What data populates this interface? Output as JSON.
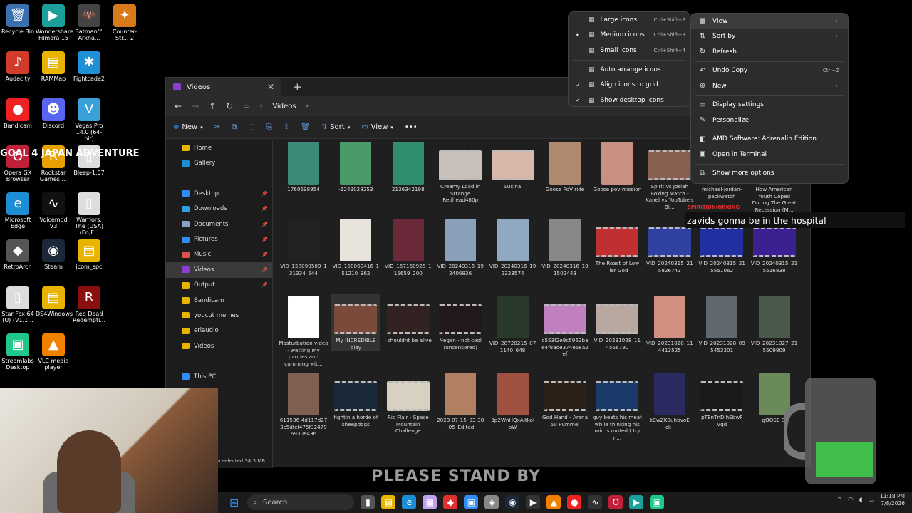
{
  "desktop": {
    "icons": [
      {
        "label": "Recycle Bin",
        "glyph": "🗑",
        "color": "#3a6fb0",
        "icon": "recycle-bin-icon"
      },
      {
        "label": "Wondershare Filmora 15",
        "glyph": "▶",
        "color": "#1b9f9a",
        "icon": "filmora-icon"
      },
      {
        "label": "Batman™ Arkha...",
        "glyph": "🦇",
        "color": "#444",
        "icon": "batman-icon"
      },
      {
        "label": "Counter-Str... 2",
        "glyph": "✦",
        "color": "#d87a1a",
        "icon": "counter-strike-icon"
      },
      {
        "label": "Audacity",
        "glyph": "♪",
        "color": "#d23a2a",
        "icon": "audacity-icon"
      },
      {
        "label": "RAMMap",
        "glyph": "▤",
        "color": "#e8b400",
        "icon": "folder-icon"
      },
      {
        "label": "Fightcade2",
        "glyph": "✱",
        "color": "#1f8fd6",
        "icon": "fightcade-icon"
      },
      {
        "label": "Bandicam",
        "glyph": "●",
        "color": "#e22",
        "icon": "bandicam-icon"
      },
      {
        "label": "Discord",
        "glyph": "☻",
        "color": "#5865f2",
        "icon": "discord-icon"
      },
      {
        "label": "Vegas Pro 14.0 (64-bit)",
        "glyph": "V",
        "color": "#3aa0d8",
        "icon": "vegas-icon"
      },
      {
        "label": "Opera GX Browser",
        "glyph": "O",
        "color": "#c0203a",
        "icon": "opera-icon"
      },
      {
        "label": "Rockstar Games ...",
        "glyph": "R",
        "color": "#e6a000",
        "icon": "rockstar-icon"
      },
      {
        "label": "Bleep-1.07",
        "glyph": "▯",
        "color": "#ddd",
        "icon": "file-icon"
      },
      {
        "label": "Microsoft Edge",
        "glyph": "e",
        "color": "#1c8ed6",
        "icon": "edge-icon"
      },
      {
        "label": "Voicemod V3",
        "glyph": "∿",
        "color": "#111",
        "icon": "voicemod-icon"
      },
      {
        "label": "Warriors, The (USA) (En,F...",
        "glyph": "▯",
        "color": "#ddd",
        "icon": "file-icon"
      },
      {
        "label": "RetroArch",
        "glyph": "◆",
        "color": "#555",
        "icon": "retroarch-icon"
      },
      {
        "label": "Steam",
        "glyph": "◉",
        "color": "#1b2838",
        "icon": "steam-icon"
      },
      {
        "label": "jcom_spc",
        "glyph": "▤",
        "color": "#e8b400",
        "icon": "folder-icon"
      },
      {
        "label": "Star Fox 64 (U) (V1.1...",
        "glyph": "▯",
        "color": "#ddd",
        "icon": "file-icon"
      },
      {
        "label": "DS4Windows",
        "glyph": "▤",
        "color": "#e8b400",
        "icon": "folder-icon"
      },
      {
        "label": "Red Dead Redempti...",
        "glyph": "R",
        "color": "#8a1010",
        "icon": "red-dead-icon"
      },
      {
        "label": "Streamlabs Desktop",
        "glyph": "▣",
        "color": "#20c78a",
        "icon": "streamlabs-icon"
      },
      {
        "label": "VLC media player",
        "glyph": "▲",
        "color": "#f08000",
        "icon": "vlc-icon"
      }
    ],
    "overlay_title": "GOAL 4 JAPAN ADVENTURE"
  },
  "explorer": {
    "tab_title": "Videos",
    "breadcrumb": "Videos",
    "toolbar": {
      "new": "New",
      "sort": "Sort",
      "view": "View"
    },
    "status": "n selected  34.3 MB",
    "nav": [
      {
        "label": "Home",
        "color": "#e8b400",
        "icon": "home-icon"
      },
      {
        "label": "Gallery",
        "color": "#1c8ed6",
        "icon": "gallery-icon"
      },
      {
        "label": "",
        "color": "",
        "icon": ""
      },
      {
        "label": "Desktop",
        "color": "#2f8df5",
        "icon": "desktop-icon",
        "pin": true
      },
      {
        "label": "Downloads",
        "color": "#2fa0e0",
        "icon": "downloads-icon",
        "pin": true
      },
      {
        "label": "Documents",
        "color": "#8aa0c8",
        "icon": "documents-icon",
        "pin": true
      },
      {
        "label": "Pictures",
        "color": "#2f8df5",
        "icon": "pictures-icon",
        "pin": true
      },
      {
        "label": "Music",
        "color": "#e0504a",
        "icon": "music-icon",
        "pin": true
      },
      {
        "label": "Videos",
        "color": "#8a3fd0",
        "icon": "videos-icon",
        "pin": true,
        "sel": true
      },
      {
        "label": "Output",
        "color": "#e8b400",
        "icon": "folder-icon",
        "pin": true
      },
      {
        "label": "Bandicam",
        "color": "#e8b400",
        "icon": "folder-icon"
      },
      {
        "label": "youcut memes",
        "color": "#e8b400",
        "icon": "folder-icon"
      },
      {
        "label": "eriaudio",
        "color": "#e8b400",
        "icon": "folder-icon"
      },
      {
        "label": "Videos",
        "color": "#e8b400",
        "icon": "folder-icon"
      },
      {
        "label": "",
        "color": "",
        "icon": ""
      },
      {
        "label": "This PC",
        "color": "#2f8df5",
        "icon": "this-pc-icon"
      }
    ],
    "files": [
      {
        "label": "1760698954",
        "color": "#3b8a7a",
        "wide": false
      },
      {
        "label": "-1249028253",
        "color": "#4a9a6a",
        "wide": false
      },
      {
        "label": "2136342198",
        "color": "#2f8f70",
        "wide": false
      },
      {
        "label": "Creamy Load in Strange Redhead480p",
        "color": "#c8c0b8",
        "wide": true
      },
      {
        "label": "Lucina",
        "color": "#d8b8a8",
        "wide": true
      },
      {
        "label": "Goose PoV ride",
        "color": "#b08a70",
        "wide": false
      },
      {
        "label": "Goose pov mission",
        "color": "#c89080",
        "wide": false
      },
      {
        "label": "Spirit vs Josiah Boxing Match - Kanel vs YouTube's Bi...",
        "color": "#8a6050",
        "wide": true
      },
      {
        "label": "michael-jordan-packwatch",
        "color": "#333",
        "wide": false
      },
      {
        "label": "How American Youth Coped During The Great Recession (M...",
        "color": "#444",
        "wide": false
      },
      {
        "label": "VID_158090509_1 31334_544",
        "color": "#222",
        "wide": false
      },
      {
        "label": "VID_158060416_1 51210_362",
        "color": "#e8e4dc",
        "wide": false
      },
      {
        "label": "VID_157160925_1 15659_200",
        "color": "#6a2a3a",
        "wide": false
      },
      {
        "label": "VID_20240316_19 2406836",
        "color": "#8aa0b8",
        "wide": false
      },
      {
        "label": "VID_20240316_19 2323574",
        "color": "#90a8c0",
        "wide": false
      },
      {
        "label": "VID_20240316_19 1502443",
        "color": "#888",
        "wide": false
      },
      {
        "label": "The Roast of Low Tier God",
        "color": "#c03030",
        "wide": true
      },
      {
        "label": "VID_20240315_21 5826743",
        "color": "#3040a0",
        "wide": true
      },
      {
        "label": "VID_20240315_21 5551062",
        "color": "#2030a0",
        "wide": true
      },
      {
        "label": "VID_20240315_21 5516838",
        "color": "#3a2090",
        "wide": true
      },
      {
        "label": "Masturbation video - wetting my panties and cumming wit...",
        "color": "#ffffff",
        "wide": false
      },
      {
        "label": "My INCREDIBLE play",
        "color": "#7a4a3a",
        "wide": true
      },
      {
        "label": "i shouldnt be alive",
        "color": "#332222",
        "wide": true
      },
      {
        "label": "Negan - not cool (uncensored)",
        "color": "#221a1a",
        "wide": true
      },
      {
        "label": "VID_28720215_07 1140_648",
        "color": "#2a3a2a",
        "wide": false
      },
      {
        "label": "c553f2e9c5962ba e4f8ade374e58a2 ef",
        "color": "#c080c0",
        "wide": true
      },
      {
        "label": "VID_20231028_11 4556790",
        "color": "#b8a8a0",
        "wide": true
      },
      {
        "label": "VID_20231028_11 4413525",
        "color": "#d09080",
        "wide": false
      },
      {
        "label": "VID_20231028_09 5453301",
        "color": "#606870",
        "wide": false
      },
      {
        "label": "VID_20231027_21 5509809",
        "color": "#4a5a4a",
        "wide": false
      },
      {
        "label": "611536-4d117d27 3c5dfcf475f32479 6930e436",
        "color": "#806050",
        "wide": false
      },
      {
        "label": "fightin a horde of sheepdogs",
        "color": "#1a2a3a",
        "wide": true
      },
      {
        "label": "Ric Flair - Space Mountain Challenge",
        "color": "#d8d0c0",
        "wide": true
      },
      {
        "label": "2023-07-15_03-38 -05_Edited",
        "color": "#b08060",
        "wide": false
      },
      {
        "label": "3p2WnHQxAitkol pW",
        "color": "#a05040",
        "wide": false
      },
      {
        "label": "God Hand - Arena 50 Pummel",
        "color": "#2a2018",
        "wide": true
      },
      {
        "label": "guy beats his meat while thinking his mic is muted ( try n...",
        "color": "#1a3a6a",
        "wide": true
      },
      {
        "label": "kCwZK0uhbvoE ck_",
        "color": "#2a2a60",
        "wide": false
      },
      {
        "label": "pTEnTnDjhSbwF Vqd",
        "color": "#1a1a1a",
        "wide": true
      },
      {
        "label": "gOOSE BJ",
        "color": "#6a8a5a",
        "wide": false
      }
    ]
  },
  "view_menu": {
    "items": [
      {
        "label": "Large icons",
        "shortcut": "Ctrl+Shift+2",
        "mark": "",
        "icon": "large-icons-icon"
      },
      {
        "label": "Medium icons",
        "shortcut": "Ctrl+Shift+3",
        "mark": "•",
        "icon": "medium-icons-icon"
      },
      {
        "label": "Small icons",
        "shortcut": "Ctrl+Shift+4",
        "mark": "",
        "icon": "small-icons-icon"
      },
      {
        "label": "Auto arrange icons",
        "shortcut": "",
        "mark": "",
        "icon": "auto-arrange-icon"
      },
      {
        "label": "Align icons to grid",
        "shortcut": "",
        "mark": "✓",
        "icon": "align-grid-icon"
      },
      {
        "label": "Show desktop icons",
        "shortcut": "",
        "mark": "✓",
        "icon": "show-desktop-icon"
      }
    ]
  },
  "context_menu": {
    "items": [
      {
        "label": "View",
        "shortcut": "",
        "arrow": true,
        "glyph": "▦",
        "icon": "view-icon",
        "hover": true
      },
      {
        "label": "Sort by",
        "shortcut": "",
        "arrow": true,
        "glyph": "⇅",
        "icon": "sort-icon"
      },
      {
        "label": "Refresh",
        "shortcut": "",
        "arrow": false,
        "glyph": "↻",
        "icon": "refresh-icon"
      },
      {
        "sep": true
      },
      {
        "label": "Undo Copy",
        "shortcut": "Ctrl+Z",
        "arrow": false,
        "glyph": "↶",
        "icon": "undo-icon"
      },
      {
        "label": "New",
        "shortcut": "",
        "arrow": true,
        "glyph": "⊕",
        "icon": "new-icon"
      },
      {
        "sep": true
      },
      {
        "label": "Display settings",
        "shortcut": "",
        "arrow": false,
        "glyph": "▭",
        "icon": "display-icon"
      },
      {
        "label": "Personalize",
        "shortcut": "",
        "arrow": false,
        "glyph": "✎",
        "icon": "personalize-icon"
      },
      {
        "sep": true
      },
      {
        "label": "AMD Software: Adrenalin Edition",
        "shortcut": "",
        "arrow": false,
        "glyph": "◧",
        "icon": "amd-icon"
      },
      {
        "label": "Open in Terminal",
        "shortcut": "",
        "arrow": false,
        "glyph": "▣",
        "icon": "terminal-icon"
      },
      {
        "sep": true
      },
      {
        "label": "Show more options",
        "shortcut": "",
        "arrow": false,
        "glyph": "⧉",
        "icon": "more-options-icon"
      }
    ]
  },
  "chat": {
    "username": "SPIRITJUNIORKING",
    "message": "zavids gonna be in the hospital"
  },
  "stream": {
    "standby": "PLEASE STAND BY"
  },
  "taskbar": {
    "search_placeholder": "Search",
    "time": "11:18 PM",
    "date": "7/8/2026",
    "apps": [
      {
        "glyph": "▮",
        "color": "#555",
        "icon": "task-view-icon"
      },
      {
        "glyph": "▤",
        "color": "#e8b400",
        "icon": "file-explorer-icon"
      },
      {
        "glyph": "e",
        "color": "#1c8ed6",
        "icon": "edge-icon"
      },
      {
        "glyph": "▦",
        "color": "#c0a0f0",
        "icon": "store-icon"
      },
      {
        "glyph": "◆",
        "color": "#e03030",
        "icon": "app-icon"
      },
      {
        "glyph": "▣",
        "color": "#2f8df5",
        "icon": "app-icon"
      },
      {
        "glyph": "◈",
        "color": "#888",
        "icon": "app-icon"
      },
      {
        "glyph": "◉",
        "color": "#1b2838",
        "icon": "steam-icon"
      },
      {
        "glyph": "▶",
        "color": "#333",
        "icon": "media-icon"
      },
      {
        "glyph": "▲",
        "color": "#f08000",
        "icon": "vlc-icon"
      },
      {
        "glyph": "●",
        "color": "#e22",
        "icon": "bandicam-icon"
      },
      {
        "glyph": "∿",
        "color": "#333",
        "icon": "voicemod-icon"
      },
      {
        "glyph": "O",
        "color": "#c0203a",
        "icon": "opera-icon"
      },
      {
        "glyph": "▶",
        "color": "#1b9f9a",
        "icon": "filmora-icon"
      },
      {
        "glyph": "▣",
        "color": "#20c78a",
        "icon": "streamlabs-icon"
      }
    ]
  }
}
